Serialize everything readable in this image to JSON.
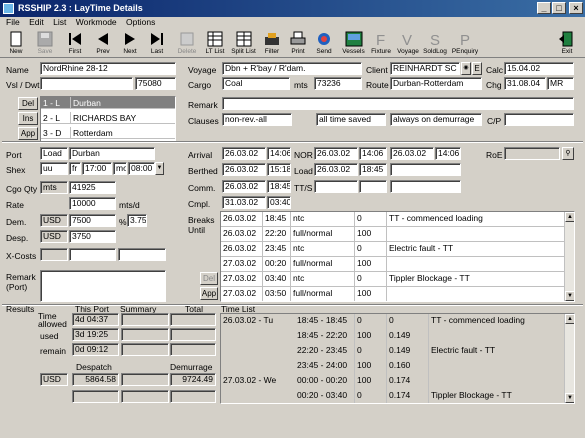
{
  "window": {
    "title": "RSSHIP 2.3 : LayTime Details"
  },
  "menu": [
    "File",
    "Edit",
    "List",
    "Workmode",
    "Options"
  ],
  "toolbar": [
    {
      "label": "New",
      "icon": "new-doc-icon"
    },
    {
      "label": "Save",
      "icon": "save-icon",
      "disabled": true
    },
    {
      "label": "First",
      "icon": "first-icon"
    },
    {
      "label": "Prev",
      "icon": "prev-icon"
    },
    {
      "label": "Next",
      "icon": "next-icon"
    },
    {
      "label": "Last",
      "icon": "last-icon"
    },
    {
      "label": "Delete",
      "icon": "delete-icon",
      "disabled": true
    },
    {
      "label": "LT List",
      "icon": "lt-list-icon"
    },
    {
      "label": "Split List",
      "icon": "split-list-icon"
    },
    {
      "label": "Filter",
      "icon": "filter-icon"
    },
    {
      "label": "Print",
      "icon": "print-icon"
    },
    {
      "label": "Send",
      "icon": "send-icon"
    },
    {
      "label": "Vessels",
      "icon": "vessels-icon"
    },
    {
      "label": "Fixture",
      "icon": "fixture-icon"
    },
    {
      "label": "Voyage",
      "icon": "voyage-icon"
    },
    {
      "label": "SoldLog",
      "icon": "soldlog-icon"
    },
    {
      "label": "PEnquiry",
      "icon": "penquiry-icon"
    },
    {
      "label": "Exit",
      "icon": "exit-icon"
    }
  ],
  "vessel": {
    "name_label": "Name",
    "name": "NordRhine 28-12",
    "dwt_label": "Vsl / Dwt",
    "dwt": "75080"
  },
  "voyage": {
    "label": "Voyage",
    "value": "Dbn + R'bay / R'dam.",
    "cargo_label": "Cargo",
    "cargo": "Coal",
    "mts_label": "mts",
    "mts": "73236",
    "client_label": "Client",
    "client": "REINHARDT SC",
    "route_label": "Route",
    "route": "Durban-Rotterdam",
    "calc_label": "Calc",
    "calc": "15.04.02",
    "chg_label": "Chg",
    "chg": "31.08.04",
    "chg_user": "MR",
    "e_btn": "E"
  },
  "ports_list": {
    "buttons": [
      "Del",
      "Ins",
      "App"
    ],
    "items": [
      {
        "code": "1 - L",
        "name": "Durban"
      },
      {
        "code": "2 - L",
        "name": "RICHARDS BAY"
      },
      {
        "code": "3 - D",
        "name": "Rotterdam"
      }
    ]
  },
  "remark": {
    "label": "Remark",
    "clauses_label": "Clauses",
    "clause1": "non-rev.-all",
    "clause2": "all time saved",
    "clause3": "always on demurrage",
    "cp_label": "C/P"
  },
  "port": {
    "label": "Port",
    "type": "Load",
    "name": "Durban",
    "shex_label": "Shex",
    "shex": "uu",
    "from": "fr",
    "from_time": "17:00",
    "to": "mo",
    "to_time": "08:00",
    "cgo_label": "Cgo Qty",
    "cgo_unit": "mts",
    "cgo": "41925",
    "rate_label": "Rate",
    "rate": "10000",
    "rate_unit": "mts/d",
    "dem_label": "Dem.",
    "dem_cur": "USD",
    "dem": "7500",
    "dem_pct": "%",
    "dem_pct_val": "3.75",
    "desp_label": "Desp.",
    "desp_cur": "USD",
    "desp": "3750",
    "xcosts_label": "X-Costs",
    "remark_label": "Remark",
    "remark_sub": "(Port)"
  },
  "times": {
    "arrival_label": "Arrival",
    "arrival_date": "26.03.02",
    "arrival_time": "14:06",
    "nor_label": "NOR",
    "nor_date": "26.03.02",
    "nor_time": "14:06",
    "nor2_date": "26.03.02",
    "nor2_time": "14:06",
    "roe_label": "RoE",
    "berthed_label": "Berthed",
    "berthed_date": "26.03.02",
    "berthed_time": "15:18",
    "load_label": "Load",
    "load_date": "26.03.02",
    "load_time": "18:45",
    "comm_label": "Comm.",
    "comm_date": "26.03.02",
    "comm_time": "18:45",
    "tts_label": "TT/S",
    "cmpl_label": "Cmpl.",
    "cmpl_date": "31.03.02",
    "cmpl_time": "03:40"
  },
  "breaks": {
    "label": "Breaks",
    "label2": "Until",
    "del": "Del",
    "app": "App",
    "rows": [
      {
        "date": "26.03.02",
        "time": "18:45",
        "type": "ntc",
        "pct": "0",
        "remark": "TT - commenced loading"
      },
      {
        "date": "26.03.02",
        "time": "22:20",
        "type": "full/normal",
        "pct": "100",
        "remark": ""
      },
      {
        "date": "26.03.02",
        "time": "23:45",
        "type": "ntc",
        "pct": "0",
        "remark": "Electric fault - TT"
      },
      {
        "date": "27.03.02",
        "time": "00:20",
        "type": "full/normal",
        "pct": "100",
        "remark": ""
      },
      {
        "date": "27.03.02",
        "time": "03:40",
        "type": "ntc",
        "pct": "0",
        "remark": "Tippler Blockage - TT"
      },
      {
        "date": "27.03.02",
        "time": "03:50",
        "type": "full/normal",
        "pct": "100",
        "remark": ""
      }
    ]
  },
  "results": {
    "label": "Results",
    "this_port": "This Port",
    "summary": "Summary",
    "total": "Total",
    "allowed_label": "Time allowed",
    "allowed_d": "4d",
    "allowed_t": "04:37",
    "used_label": "used",
    "used_d": "3d",
    "used_t": "19:25",
    "remain_label": "remain",
    "remain_d": "0d",
    "remain_t": "09:12",
    "despatch_label": "Despatch",
    "demurrage_label": "Demurrage",
    "cur": "USD",
    "despatch": "5864.58",
    "demurrage": "9724.49"
  },
  "timelist": {
    "label": "Time List",
    "rows": [
      {
        "day": "26.03.02 - Tu",
        "range": "18:45 - 18:45",
        "pct": "0",
        "factor": "0",
        "remark": "TT - commenced loading"
      },
      {
        "day": "",
        "range": "18:45 - 22:20",
        "pct": "100",
        "factor": "0.149",
        "remark": ""
      },
      {
        "day": "",
        "range": "22:20 - 23:45",
        "pct": "0",
        "factor": "0.149",
        "remark": "Electric fault - TT"
      },
      {
        "day": "",
        "range": "23:45 - 24:00",
        "pct": "100",
        "factor": "0.160",
        "remark": ""
      },
      {
        "day": "27.03.02 - We",
        "range": "00:00 - 00:20",
        "pct": "100",
        "factor": "0.174",
        "remark": ""
      },
      {
        "day": "",
        "range": "00:20 - 03:40",
        "pct": "0",
        "factor": "0.174",
        "remark": "Tippler Blockage - TT"
      }
    ]
  }
}
